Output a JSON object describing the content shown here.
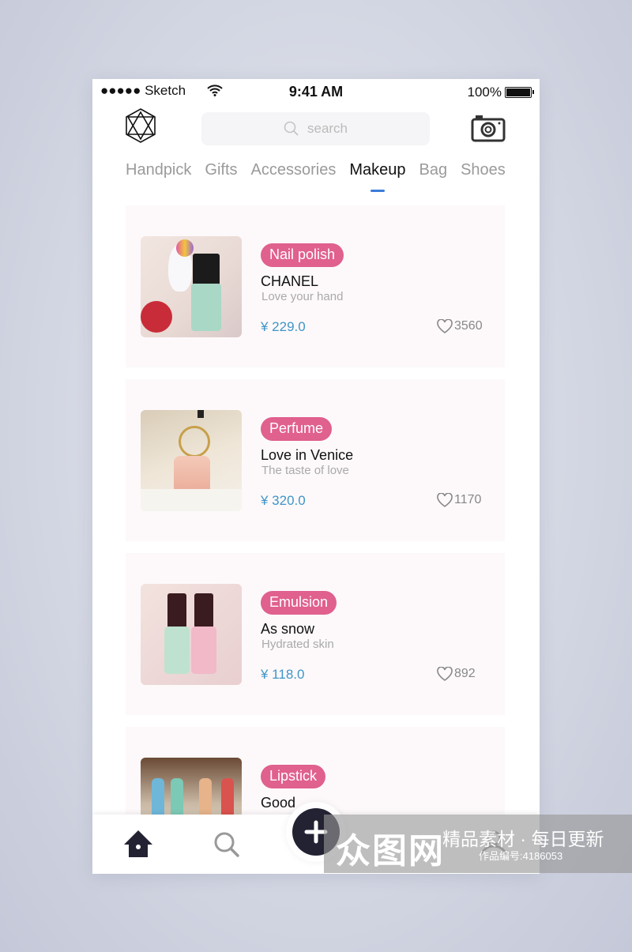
{
  "status": {
    "carrier": "●●●●● Sketch",
    "time": "9:41 AM",
    "battery": "100%"
  },
  "header": {
    "search_placeholder": "search",
    "logo_icon": "hexagon-gem-icon",
    "camera_icon": "camera-icon"
  },
  "tabs": [
    {
      "label": "Handpick"
    },
    {
      "label": "Gifts"
    },
    {
      "label": "Accessories"
    },
    {
      "label": "Makeup",
      "active": true
    },
    {
      "label": "Bag"
    },
    {
      "label": "Shoes"
    }
  ],
  "colors": {
    "tag": "#e0608e",
    "price": "#3f95c8",
    "active_tab_indicator": "#3b7bd8",
    "nav_dark": "#232233"
  },
  "products": [
    {
      "tag": "Nail polish",
      "title": "CHANEL",
      "subtitle": "Love your hand",
      "price": "¥ 229.0",
      "likes": "3560"
    },
    {
      "tag": "Perfume",
      "title": "Love in Venice",
      "subtitle": "The taste of love",
      "price": "¥ 320.0",
      "likes": "1170"
    },
    {
      "tag": "Emulsion",
      "title": "As snow",
      "subtitle": "Hydrated skin",
      "price": "¥ 118.0",
      "likes": "892"
    },
    {
      "tag": "Lipstick",
      "title": "Good"
    }
  ],
  "nav": {
    "items": [
      "home-icon",
      "search-icon",
      "add-icon",
      "user-icon"
    ]
  },
  "watermark": {
    "brand": "众图网",
    "slogan": "精品素材 · 每日更新",
    "code": "作品编号:4186053"
  }
}
